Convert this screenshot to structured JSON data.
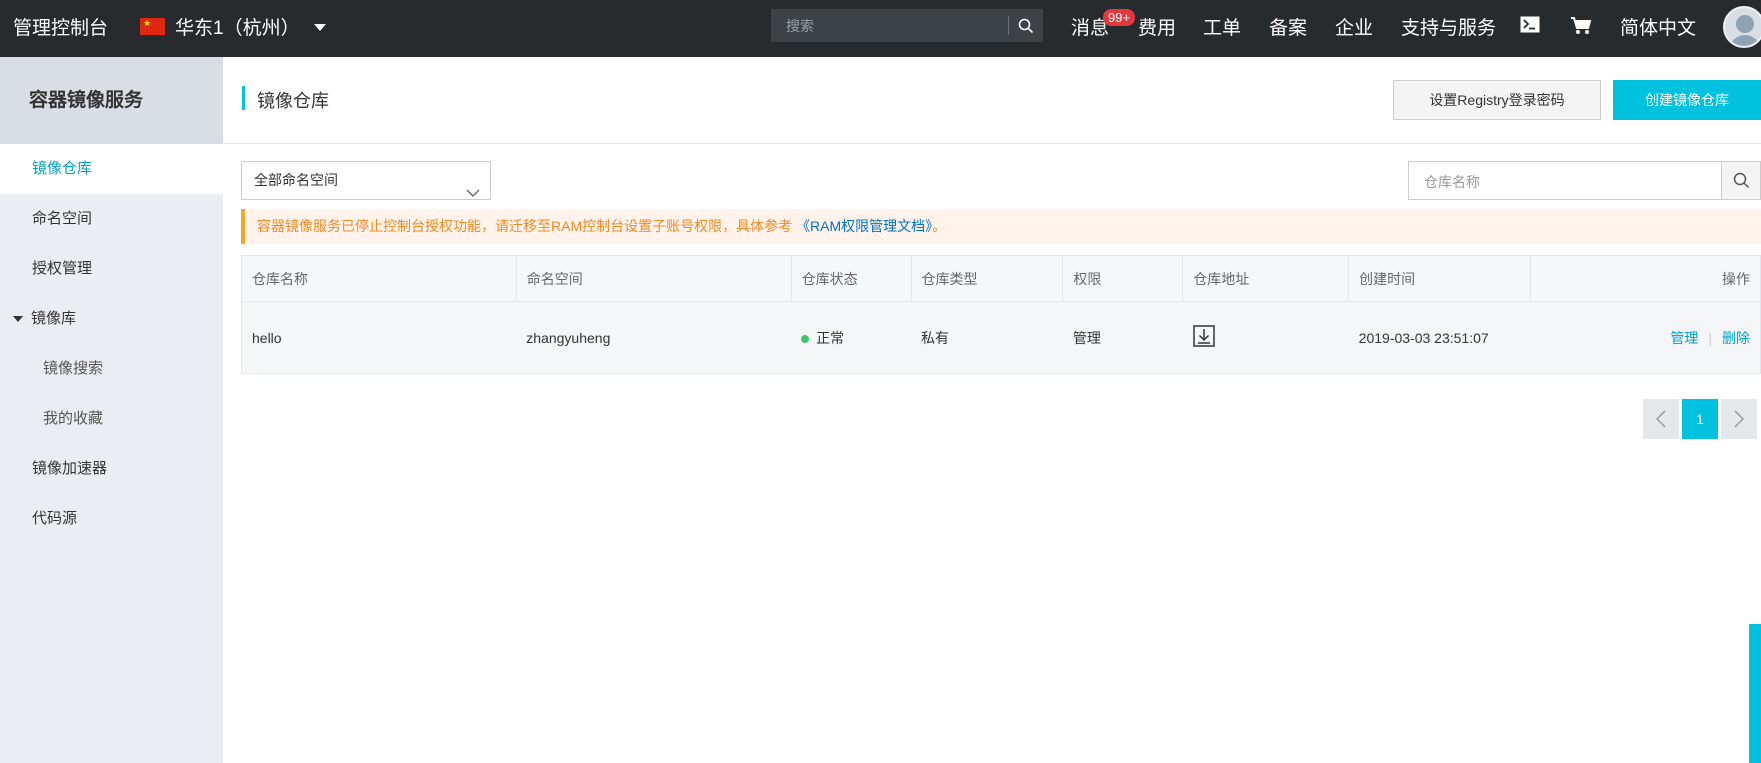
{
  "topbar": {
    "brand": "管理控制台",
    "region": "华东1（杭州）",
    "search_placeholder": "搜索",
    "nav": {
      "messages": "消息",
      "messages_badge": "99+",
      "billing": "费用",
      "tickets": "工单",
      "icp": "备案",
      "enterprise": "企业",
      "support": "支持与服务",
      "language": "简体中文"
    }
  },
  "sidebar": {
    "title": "容器镜像服务",
    "items": [
      {
        "label": "镜像仓库"
      },
      {
        "label": "命名空间"
      },
      {
        "label": "授权管理"
      },
      {
        "label": "镜像库"
      },
      {
        "label": "镜像搜索"
      },
      {
        "label": "我的收藏"
      },
      {
        "label": "镜像加速器"
      },
      {
        "label": "代码源"
      }
    ]
  },
  "header": {
    "title": "镜像仓库",
    "set_password_button": "设置Registry登录密码",
    "create_repo_button": "创建镜像仓库"
  },
  "filters": {
    "namespace_select": "全部命名空间",
    "repo_search_placeholder": "仓库名称"
  },
  "notice": {
    "text": "容器镜像服务已停止控制台授权功能，请迁移至RAM控制台设置子账号权限，具体参考",
    "link": "《RAM权限管理文档》",
    "suffix": "。"
  },
  "table": {
    "columns": [
      "仓库名称",
      "命名空间",
      "仓库状态",
      "仓库类型",
      "权限",
      "仓库地址",
      "创建时间",
      "操作"
    ],
    "rows": [
      {
        "name": "hello",
        "namespace": "zhangyuheng",
        "status": "正常",
        "type": "私有",
        "permission": "管理",
        "created": "2019-03-03 23:51:07",
        "action_manage": "管理",
        "action_separator": "|",
        "action_delete": "删除"
      }
    ]
  },
  "pagination": {
    "current_page": "1"
  },
  "colors": {
    "topbar_bg": "#272b2e",
    "accent": "#00c1de",
    "link": "#00a2ca",
    "notice_text": "#f08a24",
    "status_ok": "#42c46a"
  },
  "icons": [
    "search-icon",
    "terminal-icon",
    "cart-icon",
    "chevron-down-icon",
    "download-icon",
    "chevron-left-icon",
    "chevron-right-icon"
  ]
}
